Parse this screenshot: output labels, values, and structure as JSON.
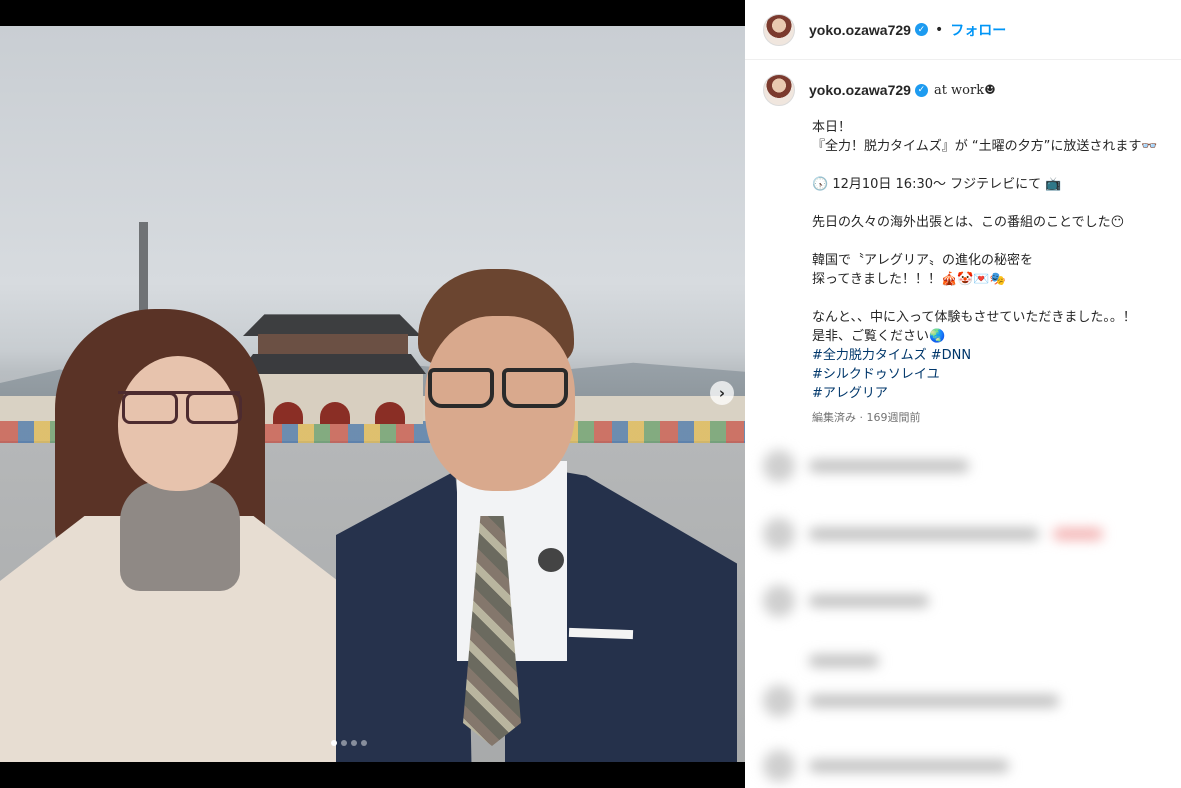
{
  "post": {
    "username": "yoko.ozawa729",
    "verified": true,
    "follow_label": "フォロー",
    "separator": "•",
    "location": "at work☻",
    "caption": "本日！\n『全力！脱力タイムズ』が “土曜の夕方”に放送されます👓\n\n🕟 12月10日 16:30〜 フジテレビにて 📺\n\n先日の久々の海外出張とは、この番組のことでした😶\n\n韓国で〝アレグリア〟の進化の秘密を\n探ってきました！！！🎪🤡💌🎭\n\nなんと、、中に入って体験もさせていただきました。。！\n是非、ご覧ください🌏",
    "hashtags": [
      "#全力脱力タイムズ #DNN",
      "#シルクドゥソレイユ",
      "#アレグリア"
    ],
    "meta": "編集済み · 169週間前"
  },
  "media": {
    "carousel_next_icon": "›",
    "slide_count": 4,
    "active_slide": 1
  },
  "colors": {
    "link_blue": "#0095f6",
    "hashtag": "#00376b",
    "verified": "#1d9bf0",
    "muted": "#737373"
  },
  "icons": {
    "verified": "verified-badge-icon",
    "next": "chevron-right-icon"
  }
}
